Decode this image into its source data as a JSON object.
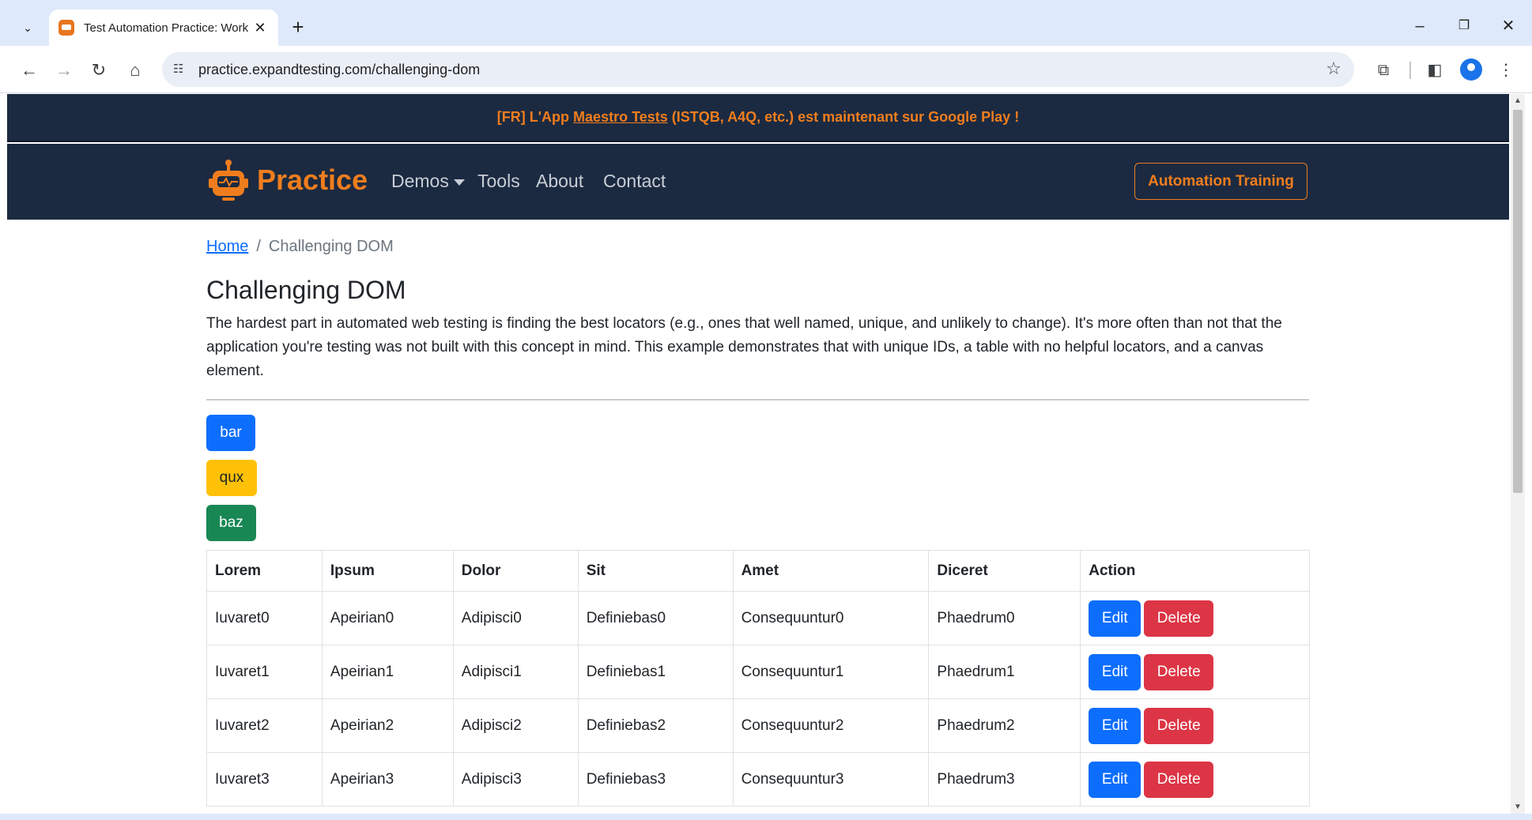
{
  "browser": {
    "tab_title": "Test Automation Practice: Work",
    "url": "practice.expandtesting.com/challenging-dom"
  },
  "announcement": {
    "prefix": "[FR] L'App ",
    "link": "Maestro Tests",
    "suffix": " (ISTQB, A4Q, etc.) est maintenant sur Google Play !"
  },
  "navbar": {
    "brand": "Practice",
    "links": [
      "Demos",
      "Tools",
      "About",
      "Contact"
    ],
    "cta": "Automation Training"
  },
  "breadcrumb": {
    "home": "Home",
    "current": "Challenging DOM"
  },
  "page": {
    "title": "Challenging DOM",
    "description": "The hardest part in automated web testing is finding the best locators (e.g., ones that well named, unique, and unlikely to change). It's more often than not that the application you're testing was not built with this concept in mind. This example demonstrates that with unique IDs, a table with no helpful locators, and a canvas element."
  },
  "buttons": {
    "bar": "bar",
    "qux": "qux",
    "baz": "baz"
  },
  "table": {
    "headers": [
      "Lorem",
      "Ipsum",
      "Dolor",
      "Sit",
      "Amet",
      "Diceret",
      "Action"
    ],
    "rows": [
      [
        "Iuvaret0",
        "Apeirian0",
        "Adipisci0",
        "Definiebas0",
        "Consequuntur0",
        "Phaedrum0"
      ],
      [
        "Iuvaret1",
        "Apeirian1",
        "Adipisci1",
        "Definiebas1",
        "Consequuntur1",
        "Phaedrum1"
      ],
      [
        "Iuvaret2",
        "Apeirian2",
        "Adipisci2",
        "Definiebas2",
        "Consequuntur2",
        "Phaedrum2"
      ],
      [
        "Iuvaret3",
        "Apeirian3",
        "Adipisci3",
        "Definiebas3",
        "Consequuntur3",
        "Phaedrum3"
      ]
    ],
    "edit_label": "Edit",
    "delete_label": "Delete"
  },
  "colors": {
    "brand_orange": "#f07d1d",
    "navy": "#1b2a41",
    "primary": "#0d6efd",
    "warning": "#ffc107",
    "success": "#198754",
    "danger": "#dc3545"
  },
  "icons": [
    "tab-search-icon",
    "favicon-robot-icon",
    "close-icon",
    "plus-icon",
    "minimize-icon",
    "restore-icon",
    "back-arrow-icon",
    "forward-arrow-icon",
    "reload-icon",
    "home-icon",
    "site-info-icon",
    "star-icon",
    "extensions-icon",
    "side-panel-icon",
    "profile-icon",
    "menu-dots-icon",
    "robot-logo-icon"
  ]
}
